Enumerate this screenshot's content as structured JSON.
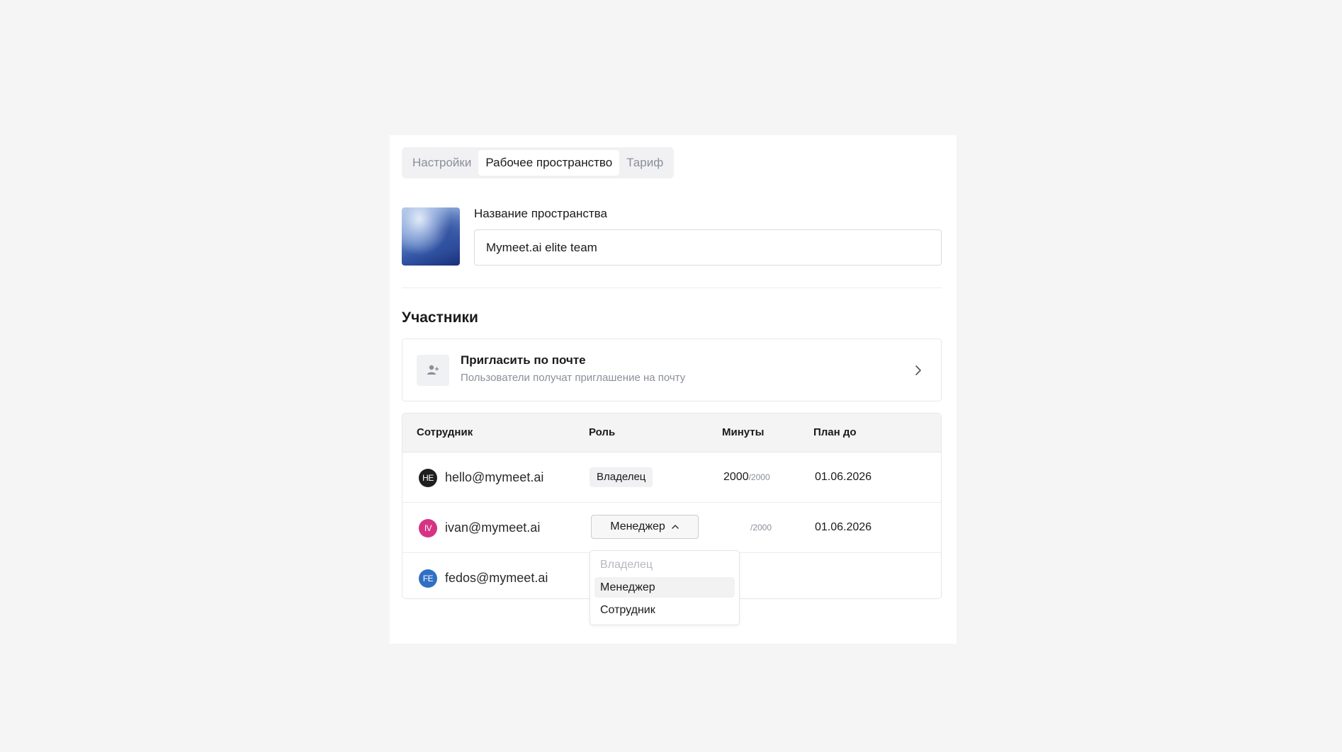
{
  "tabs": [
    {
      "label": "Настройки",
      "active": false
    },
    {
      "label": "Рабочее пространство",
      "active": true
    },
    {
      "label": "Тариф",
      "active": false
    }
  ],
  "workspace": {
    "name_label": "Название пространства",
    "name_value": "Mymeet.ai elite team"
  },
  "members": {
    "title": "Участники",
    "invite": {
      "title": "Пригласить по почте",
      "subtitle": "Пользователи получат приглашение на почту",
      "icon": "user-plus-icon"
    },
    "columns": [
      "Сотрудник",
      "Роль",
      "Минуты",
      "План до"
    ],
    "rows": [
      {
        "initials": "HE",
        "avatar_color": "#1f1f1f",
        "email": "hello@mymeet.ai",
        "role": "Владелец",
        "minutes_used": "2000",
        "minutes_total": "/2000",
        "plan_until": "01.06.2026"
      },
      {
        "initials": "IV",
        "avatar_color": "#d63384",
        "email": "ivan@mymeet.ai",
        "role": "Менеджер",
        "minutes_used": "",
        "minutes_total": "/2000",
        "plan_until": "01.06.2026"
      },
      {
        "initials": "FE",
        "avatar_color": "#2f6fc4",
        "email": "fedos@mymeet.ai",
        "role": "",
        "minutes_used": "",
        "minutes_total": "",
        "plan_until": ""
      }
    ],
    "role_dropdown": {
      "options": [
        {
          "label": "Владелец",
          "disabled": true
        },
        {
          "label": "Менеджер",
          "highlighted": true
        },
        {
          "label": "Сотрудник"
        }
      ]
    }
  }
}
